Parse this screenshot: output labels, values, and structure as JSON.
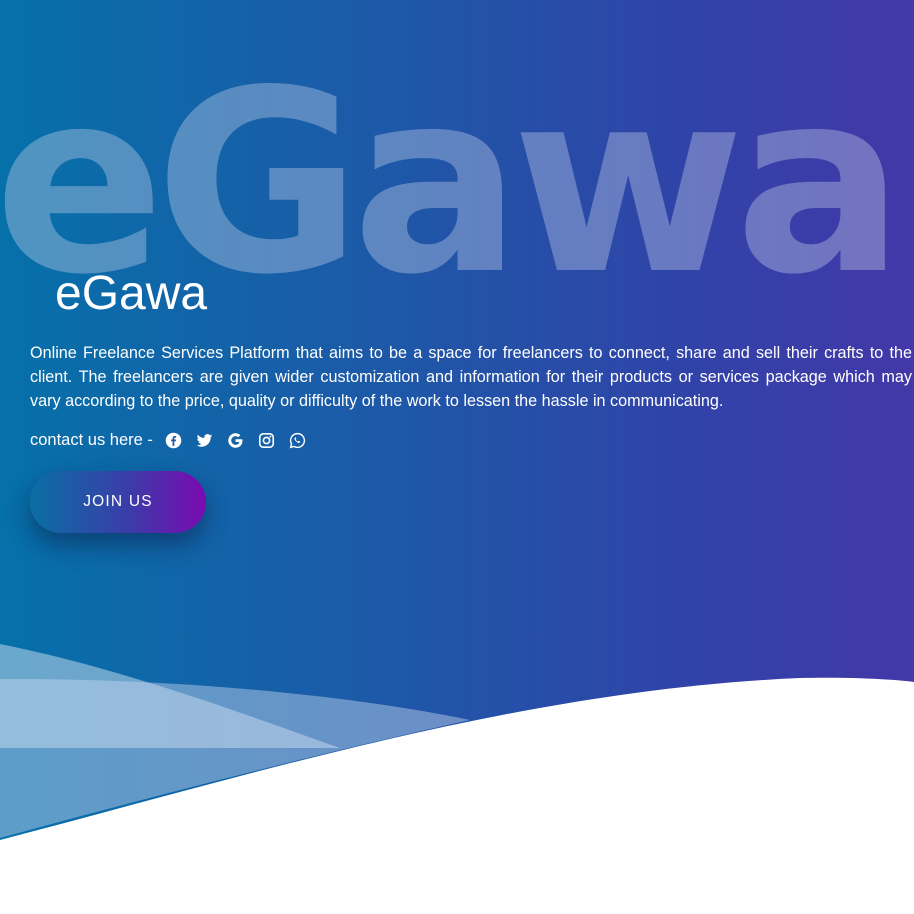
{
  "hero": {
    "watermark": "eGawa",
    "brand": "eGawa",
    "description": "Online Freelance Services Platform that aims to be a space for freelancers to connect, share and sell their crafts to the client. The freelancers are given wider customization and information for their products or services package which may vary according to the price, quality or difficulty of the work to lessen the hassle in communicating.",
    "contact_label": "contact us here -",
    "social_icons": [
      "facebook-icon",
      "twitter-icon",
      "google-icon",
      "instagram-icon",
      "whatsapp-icon"
    ],
    "cta_label": "JOIN US"
  },
  "colors": {
    "gradient_start": "#0670a9",
    "gradient_end": "#4338a8",
    "button_start": "#0a6fa3",
    "button_end": "#7a0ab0",
    "text": "#ffffff"
  }
}
